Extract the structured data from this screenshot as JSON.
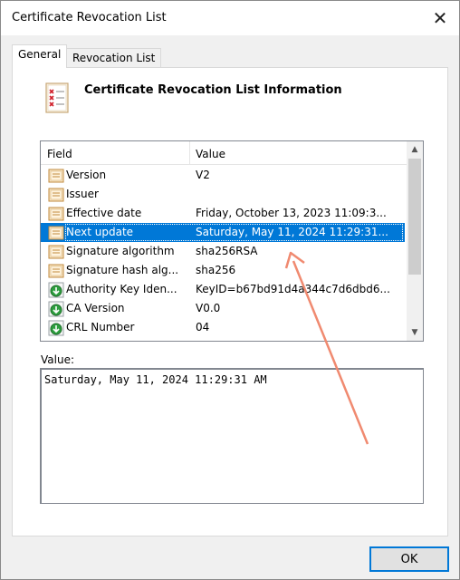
{
  "window": {
    "title": "Certificate Revocation List"
  },
  "tabs": [
    {
      "label": "General"
    },
    {
      "label": "Revocation List"
    }
  ],
  "header": {
    "title": "Certificate Revocation List Information"
  },
  "list": {
    "col_field": "Field",
    "col_value": "Value",
    "rows": [
      {
        "field": "Version",
        "value": "V2",
        "icon": "certificate-field-icon"
      },
      {
        "field": "Issuer",
        "value": "",
        "icon": "certificate-field-icon"
      },
      {
        "field": "Effective date",
        "value": "Friday, October 13, 2023 11:09:3...",
        "icon": "certificate-field-icon"
      },
      {
        "field": "Next update",
        "value": "Saturday, May 11, 2024 11:29:31...",
        "icon": "certificate-field-icon",
        "selected": true
      },
      {
        "field": "Signature algorithm",
        "value": "sha256RSA",
        "icon": "certificate-field-icon"
      },
      {
        "field": "Signature hash alg...",
        "value": "sha256",
        "icon": "certificate-field-icon"
      },
      {
        "field": "Authority Key Iden...",
        "value": "KeyID=b67bd91d4a344c7d6dbd6...",
        "icon": "extension-field-icon"
      },
      {
        "field": "CA Version",
        "value": "V0.0",
        "icon": "extension-field-icon"
      },
      {
        "field": "CRL Number",
        "value": "04",
        "icon": "extension-field-icon"
      }
    ]
  },
  "value_label": "Value:",
  "value_text": "Saturday, May 11, 2024 11:29:31 AM",
  "ok_label": "OK",
  "colors": {
    "selection": "#0078d7",
    "annotation_arrow": "#f08a70"
  }
}
